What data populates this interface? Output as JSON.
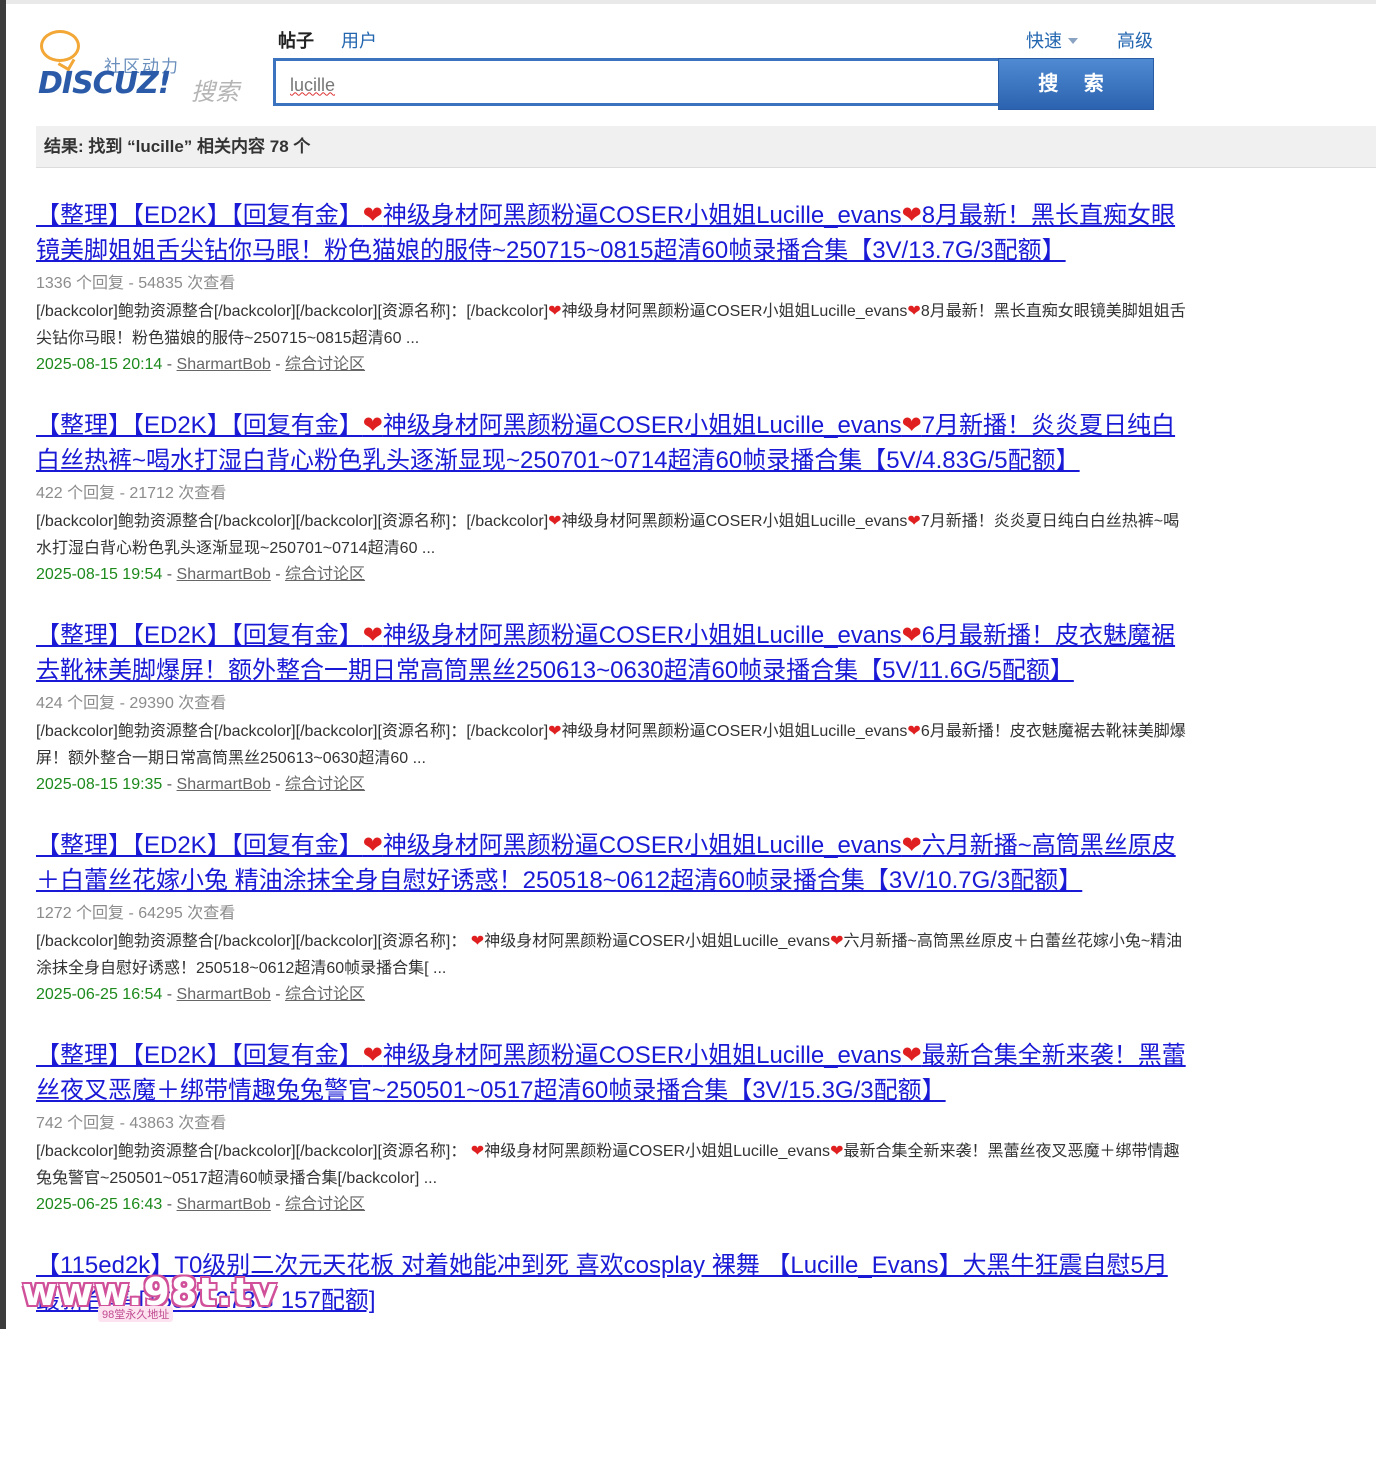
{
  "logo": {
    "cn_text": "社区动力",
    "brand": "DISCUZ!",
    "suffix": "搜索"
  },
  "search_types": [
    {
      "label": "帖子"
    },
    {
      "label": "用户"
    }
  ],
  "quick_links": {
    "fast": "快速",
    "advanced": "高级"
  },
  "search": {
    "query": "lucille",
    "button": "搜 索"
  },
  "result_summary": "结果: 找到 “lucille” 相关内容 78 个",
  "results": [
    {
      "title_a": "【整理】【ED2K】【回复有金】",
      "title_b": "神级身材阿黑颜粉逼COSER小姐姐Lucille_evans",
      "title_c": "8月最新！黑长直痴女眼镜美脚姐姐舌尖钻你马眼！粉色猫娘的服侍~250715~0815超清60帧录播合集【3V/13.7G/3配额】",
      "meta": "1336 个回复 - 54835 次查看",
      "snippet_a": "[/backcolor]鲍勃资源整合[/backcolor][/backcolor][资源名称]：[/backcolor]",
      "snippet_b": "神级身材阿黑颜粉逼COSER小姐姐Lucille_evans",
      "snippet_c": "8月最新！黑长直痴女眼镜美脚姐姐舌尖钻你马眼！粉色猫娘的服侍~250715~0815超清60 ...",
      "date": "2025-08-15 20:14",
      "author": "SharmartBob",
      "forum": "综合讨论区"
    },
    {
      "title_a": "【整理】【ED2K】【回复有金】",
      "title_b": "神级身材阿黑颜粉逼COSER小姐姐Lucille_evans",
      "title_c": "7月新播！炎炎夏日纯白白丝热裤~喝水打湿白背心粉色乳头逐渐显现~250701~0714超清60帧录播合集【5V/4.83G/5配额】",
      "meta": "422 个回复 - 21712 次查看",
      "snippet_a": "[/backcolor]鲍勃资源整合[/backcolor][/backcolor][资源名称]：[/backcolor]",
      "snippet_b": "神级身材阿黑颜粉逼COSER小姐姐Lucille_evans",
      "snippet_c": "7月新播！炎炎夏日纯白白丝热裤~喝水打湿白背心粉色乳头逐渐显现~250701~0714超清60 ...",
      "date": "2025-08-15 19:54",
      "author": "SharmartBob",
      "forum": "综合讨论区"
    },
    {
      "title_a": "【整理】【ED2K】【回复有金】",
      "title_b": "神级身材阿黑颜粉逼COSER小姐姐Lucille_evans",
      "title_c": "6月最新播！皮衣魅魔裾去靴袜美脚爆屏！额外整合一期日常高筒黑丝250613~0630超清60帧录播合集【5V/11.6G/5配额】",
      "meta": "424 个回复 - 29390 次查看",
      "snippet_a": "[/backcolor]鲍勃资源整合[/backcolor][/backcolor][资源名称]：[/backcolor]",
      "snippet_b": "神级身材阿黑颜粉逼COSER小姐姐Lucille_evans",
      "snippet_c": "6月最新播！皮衣魅魔裾去靴袜美脚爆屏！额外整合一期日常高筒黑丝250613~0630超清60 ...",
      "date": "2025-08-15 19:35",
      "author": "SharmartBob",
      "forum": "综合讨论区"
    },
    {
      "title_a": "【整理】【ED2K】【回复有金】",
      "title_b": "神级身材阿黑颜粉逼COSER小姐姐Lucille_evans",
      "title_c": "六月新播~高筒黑丝原皮＋白蕾丝花嫁小兔 精油涂抹全身自慰好诱惑！250518~0612超清60帧录播合集【3V/10.7G/3配额】",
      "meta": "1272 个回复 - 64295 次查看",
      "snippet_a": "[/backcolor]鲍勃资源整合[/backcolor][/backcolor][资源名称]：",
      "snippet_b": "神级身材阿黑颜粉逼COSER小姐姐Lucille_evans",
      "snippet_c": "六月新播~高筒黑丝原皮＋白蕾丝花嫁小兔~精油涂抹全身自慰好诱惑！250518~0612超清60帧录播合集[ ...",
      "date": "2025-06-25 16:54",
      "author": "SharmartBob",
      "forum": "综合讨论区"
    },
    {
      "title_a": "【整理】【ED2K】【回复有金】",
      "title_b": "神级身材阿黑颜粉逼COSER小姐姐Lucille_evans",
      "title_c": "最新合集全新来袭！黑蕾丝夜叉恶魔＋绑带情趣兔兔警官~250501~0517超清60帧录播合集【3V/15.3G/3配额】",
      "meta": "742 个回复 - 43863 次查看",
      "snippet_a": "[/backcolor]鲍勃资源整合[/backcolor][/backcolor][资源名称]：",
      "snippet_b": "神级身材阿黑颜粉逼COSER小姐姐Lucille_evans",
      "snippet_c": "最新合集全新来袭！黑蕾丝夜叉恶魔＋绑带情趣兔兔警官~250501~0517超清60帧录播合集[/backcolor] ...",
      "date": "2025-06-25 16:43",
      "author": "SharmartBob",
      "forum": "综合讨论区"
    }
  ],
  "partial_result": {
    "title": "【115ed2k】T0级别二次元天花板 对着她能冲到死 喜欢cosplay 裸舞 【Lucille_Evans】大黑牛狂震自慰5月最新合集 [155V+273G 157配额]"
  },
  "watermark": {
    "text": "www.98t.tv",
    "sub": "98堂永久地址"
  },
  "colors": {
    "link": "#1a1ad6",
    "date": "#1c8a1c",
    "heart": "#e02020",
    "button": "#3b73be"
  }
}
